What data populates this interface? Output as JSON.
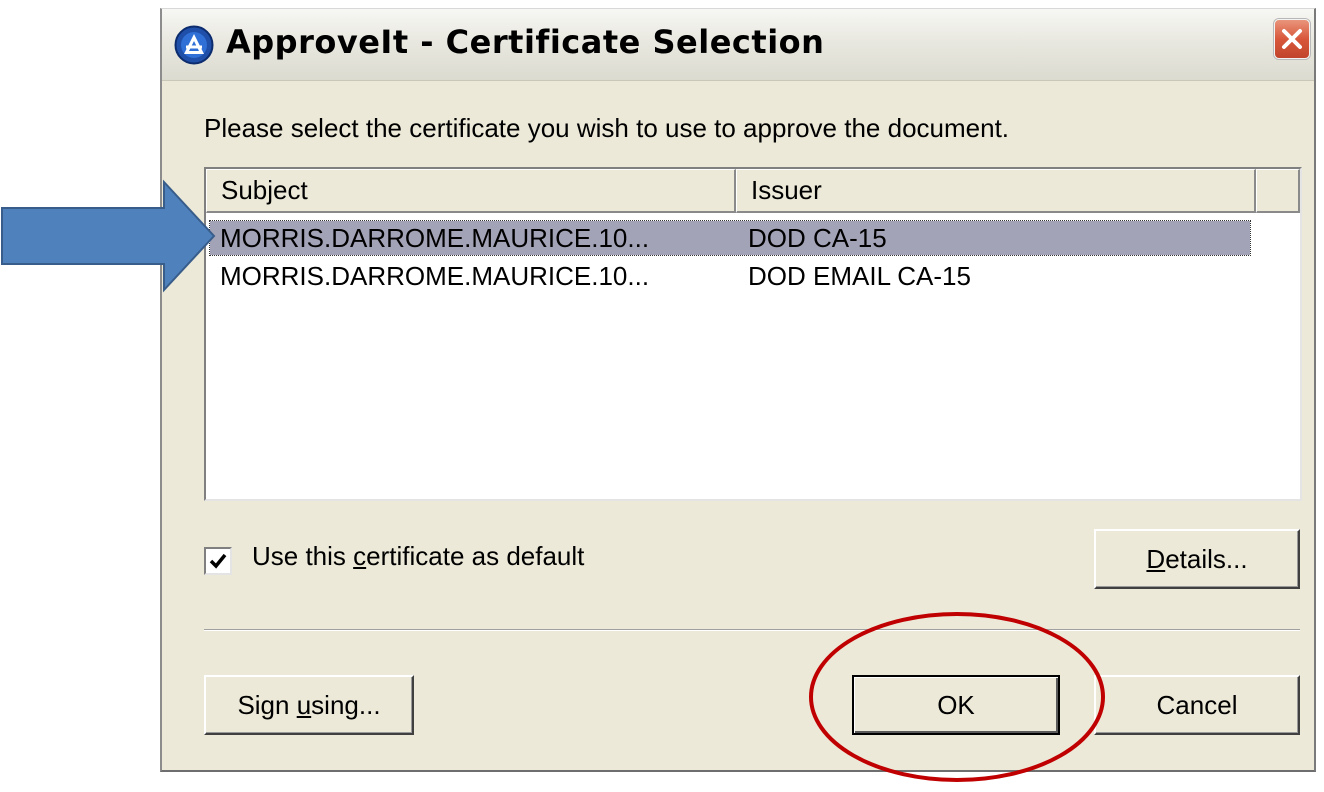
{
  "window": {
    "title": "ApproveIt - Certificate Selection",
    "app_icon": "approveit-logo-icon",
    "close_icon": "close-icon"
  },
  "dialog": {
    "prompt": "Please select the certificate you wish to use to approve the document.",
    "columns": [
      "Subject",
      "Issuer",
      ""
    ],
    "rows": [
      {
        "subject": "MORRIS.DARROME.MAURICE.10...",
        "issuer": "DOD CA-15",
        "selected": true
      },
      {
        "subject": "MORRIS.DARROME.MAURICE.10...",
        "issuer": "DOD EMAIL CA-15",
        "selected": false
      }
    ],
    "default_checkbox": {
      "checked": true,
      "label_pre": "Use this ",
      "label_accel": "c",
      "label_post": "ertificate as default"
    },
    "buttons": {
      "details": {
        "accel": "D",
        "rest": "etails..."
      },
      "sign_using": {
        "pre": "Sign ",
        "accel": "u",
        "post": "sing..."
      },
      "ok": "OK",
      "cancel": "Cancel"
    }
  },
  "annotations": {
    "arrow_icon": "pointer-arrow-icon",
    "arrow_color": "#4f81bd",
    "ellipse_color": "#c00000"
  },
  "colors": {
    "window_bg": "#ece9d8",
    "selection": "#a3a3b8",
    "close_button": "#d8573b"
  }
}
